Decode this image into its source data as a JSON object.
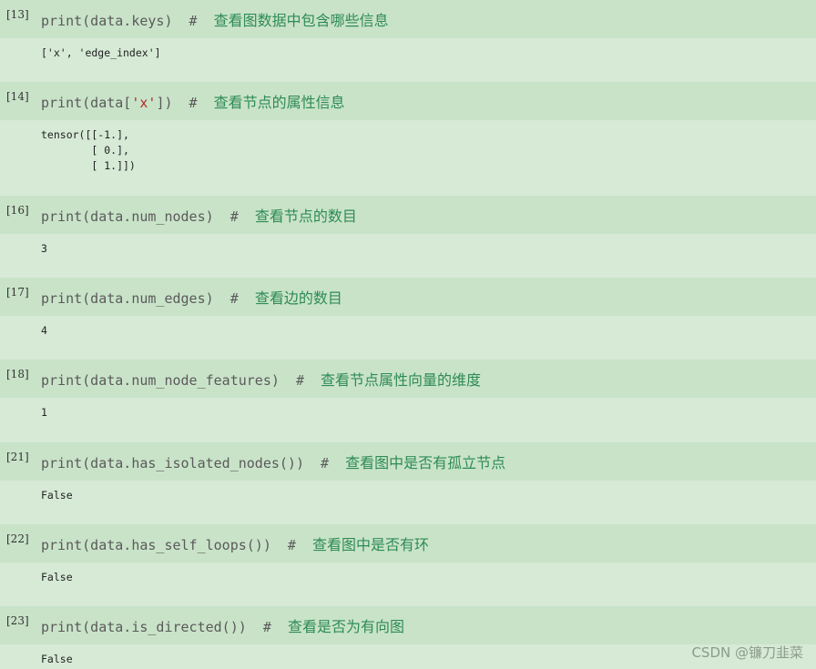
{
  "cells": [
    {
      "prompt": "[13]",
      "code_pre": "print(data.keys)  #  ",
      "code_str": "",
      "code_post": "",
      "comment": "查看图数据中包含哪些信息",
      "output": "['x', 'edge_index']"
    },
    {
      "prompt": "[14]",
      "code_pre": "print(data[",
      "code_str": "'x'",
      "code_post": "])  #  ",
      "comment": "查看节点的属性信息",
      "output": "tensor([[-1.],\n        [ 0.],\n        [ 1.]])"
    },
    {
      "prompt": "[16]",
      "code_pre": "print(data.num_nodes)  #  ",
      "code_str": "",
      "code_post": "",
      "comment": "查看节点的数目",
      "output": "3"
    },
    {
      "prompt": "[17]",
      "code_pre": "print(data.num_edges)  #  ",
      "code_str": "",
      "code_post": "",
      "comment": "查看边的数目",
      "output": "4"
    },
    {
      "prompt": "[18]",
      "code_pre": "print(data.num_node_features)  #  ",
      "code_str": "",
      "code_post": "",
      "comment": "查看节点属性向量的维度",
      "output": "1"
    },
    {
      "prompt": "[21]",
      "code_pre": "print(data.has_isolated_nodes())  #  ",
      "code_str": "",
      "code_post": "",
      "comment": "查看图中是否有孤立节点",
      "output": "False"
    },
    {
      "prompt": "[22]",
      "code_pre": "print(data.has_self_loops())  #  ",
      "code_str": "",
      "code_post": "",
      "comment": "查看图中是否有环",
      "output": "False"
    },
    {
      "prompt": "[23]",
      "code_pre": "print(data.is_directed())  #  ",
      "code_str": "",
      "code_post": "",
      "comment": "查看是否为有向图",
      "output": "False"
    }
  ],
  "watermark": "CSDN @镰刀韭菜"
}
